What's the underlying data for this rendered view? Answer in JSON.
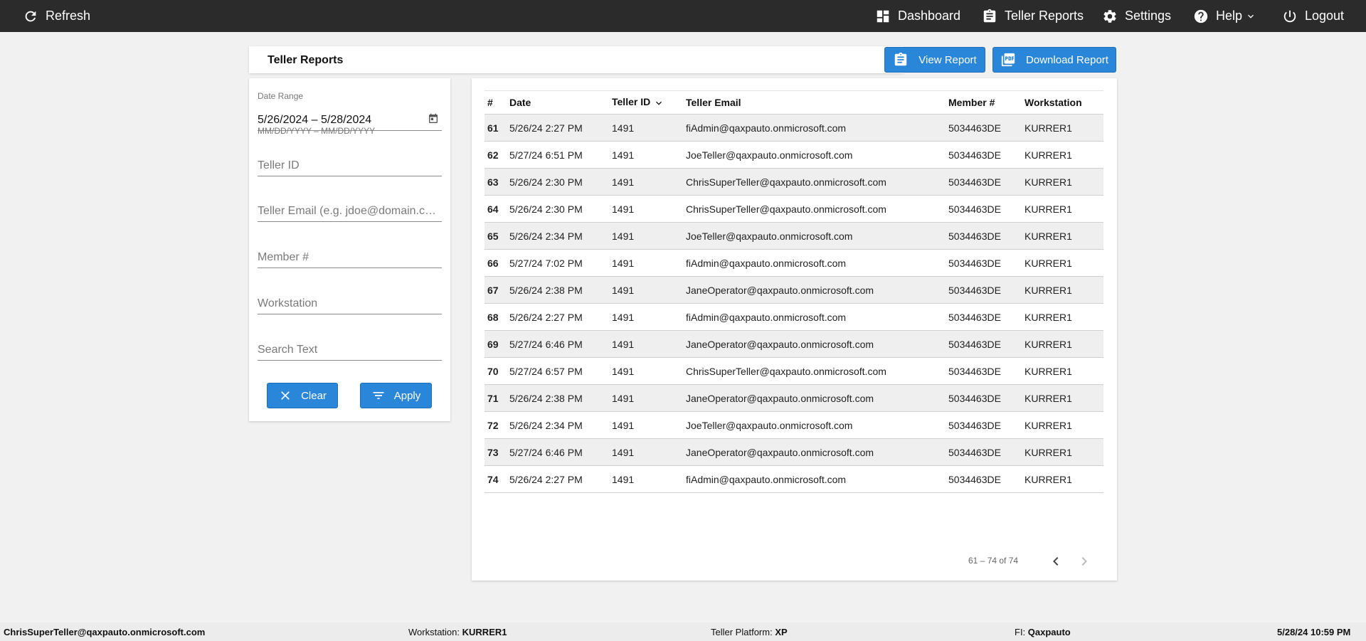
{
  "topbar": {
    "refresh_label": "Refresh",
    "dashboard_label": "Dashboard",
    "teller_reports_label": "Teller Reports",
    "settings_label": "Settings",
    "help_label": "Help",
    "logout_label": "Logout"
  },
  "title": "Teller Reports",
  "actions": {
    "view_report_label": "View Report",
    "download_report_label": "Download Report"
  },
  "filters": {
    "date_range_label": "Date Range",
    "date_range_value": "5/26/2024 – 5/28/2024",
    "date_range_hint": "MM/DD/YYYY – MM/DD/YYYY",
    "teller_id_placeholder": "Teller ID",
    "teller_email_placeholder": "Teller Email (e.g. jdoe@domain.com)",
    "member_placeholder": "Member #",
    "workstation_placeholder": "Workstation",
    "search_text_placeholder": "Search Text",
    "clear_label": "Clear",
    "apply_label": "Apply"
  },
  "table": {
    "columns": [
      "#",
      "Date",
      "Teller ID",
      "Teller Email",
      "Member #",
      "Workstation"
    ],
    "rows": [
      [
        "61",
        "5/26/24 2:27 PM",
        "1491",
        "fiAdmin@qaxpauto.onmicrosoft.com",
        "5034463DE",
        "KURRER1"
      ],
      [
        "62",
        "5/27/24 6:51 PM",
        "1491",
        "JoeTeller@qaxpauto.onmicrosoft.com",
        "5034463DE",
        "KURRER1"
      ],
      [
        "63",
        "5/26/24 2:30 PM",
        "1491",
        "ChrisSuperTeller@qaxpauto.onmicrosoft.com",
        "5034463DE",
        "KURRER1"
      ],
      [
        "64",
        "5/26/24 2:30 PM",
        "1491",
        "ChrisSuperTeller@qaxpauto.onmicrosoft.com",
        "5034463DE",
        "KURRER1"
      ],
      [
        "65",
        "5/26/24 2:34 PM",
        "1491",
        "JoeTeller@qaxpauto.onmicrosoft.com",
        "5034463DE",
        "KURRER1"
      ],
      [
        "66",
        "5/27/24 7:02 PM",
        "1491",
        "fiAdmin@qaxpauto.onmicrosoft.com",
        "5034463DE",
        "KURRER1"
      ],
      [
        "67",
        "5/26/24 2:38 PM",
        "1491",
        "JaneOperator@qaxpauto.onmicrosoft.com",
        "5034463DE",
        "KURRER1"
      ],
      [
        "68",
        "5/26/24 2:27 PM",
        "1491",
        "fiAdmin@qaxpauto.onmicrosoft.com",
        "5034463DE",
        "KURRER1"
      ],
      [
        "69",
        "5/27/24 6:46 PM",
        "1491",
        "JaneOperator@qaxpauto.onmicrosoft.com",
        "5034463DE",
        "KURRER1"
      ],
      [
        "70",
        "5/27/24 6:57 PM",
        "1491",
        "ChrisSuperTeller@qaxpauto.onmicrosoft.com",
        "5034463DE",
        "KURRER1"
      ],
      [
        "71",
        "5/26/24 2:38 PM",
        "1491",
        "JaneOperator@qaxpauto.onmicrosoft.com",
        "5034463DE",
        "KURRER1"
      ],
      [
        "72",
        "5/26/24 2:34 PM",
        "1491",
        "JoeTeller@qaxpauto.onmicrosoft.com",
        "5034463DE",
        "KURRER1"
      ],
      [
        "73",
        "5/27/24 6:46 PM",
        "1491",
        "JaneOperator@qaxpauto.onmicrosoft.com",
        "5034463DE",
        "KURRER1"
      ],
      [
        "74",
        "5/26/24 2:27 PM",
        "1491",
        "fiAdmin@qaxpauto.onmicrosoft.com",
        "5034463DE",
        "KURRER1"
      ]
    ],
    "pagination_text": "61 – 74 of 74"
  },
  "footer": {
    "user": "ChrisSuperTeller@qaxpauto.onmicrosoft.com",
    "workstation_label": "Workstation:",
    "workstation_value": "KURRER1",
    "platform_label": "Teller Platform:",
    "platform_value": "XP",
    "fi_label": "FI:",
    "fi_value": "Qaxpauto",
    "datetime": "5/28/24 10:59 PM"
  },
  "colors": {
    "topbar_bg": "#2b2b2b",
    "accent_blue": "#2a86d8",
    "page_bg": "#f1f1f1",
    "row_stripe": "#efefef"
  },
  "icons": [
    "refresh-icon",
    "dashboard-icon",
    "clipboard-icon",
    "gear-icon",
    "help-icon",
    "chevron-down-icon",
    "power-icon",
    "pdf-icon",
    "calendar-icon",
    "close-icon",
    "filter-icon",
    "sort-arrow-icon",
    "chevron-left-icon",
    "chevron-right-icon"
  ]
}
